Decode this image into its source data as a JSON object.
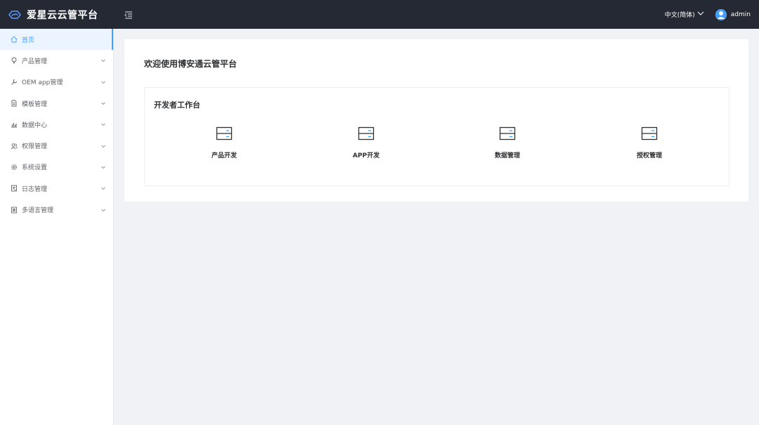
{
  "app": {
    "brand_name": "爱星云云管平台"
  },
  "topbar": {
    "language": "中文(简体)",
    "username": "admin"
  },
  "sidebar": {
    "items": [
      {
        "label": "首页",
        "icon": "home-icon",
        "active": true
      },
      {
        "label": "产品管理",
        "icon": "bulb-icon"
      },
      {
        "label": "OEM app管理",
        "icon": "wrench-icon"
      },
      {
        "label": "模板管理",
        "icon": "document-icon"
      },
      {
        "label": "数据中心",
        "icon": "chart-icon"
      },
      {
        "label": "权限管理",
        "icon": "users-icon"
      },
      {
        "label": "系统设置",
        "icon": "gear-icon"
      },
      {
        "label": "日志管理",
        "icon": "log-icon"
      },
      {
        "label": "多语言管理",
        "icon": "list-icon"
      }
    ]
  },
  "main": {
    "welcome": "欢迎使用博安通云管平台",
    "workbench": {
      "title": "开发者工作台",
      "items": [
        {
          "label": "产品开发",
          "icon": "server-icon"
        },
        {
          "label": "APP开发",
          "icon": "server-icon"
        },
        {
          "label": "数据管理",
          "icon": "server-icon"
        },
        {
          "label": "授权管理",
          "icon": "server-icon"
        }
      ]
    }
  },
  "colors": {
    "accent": "#409eff",
    "topbar": "#252933",
    "background": "#f0f2f5"
  }
}
